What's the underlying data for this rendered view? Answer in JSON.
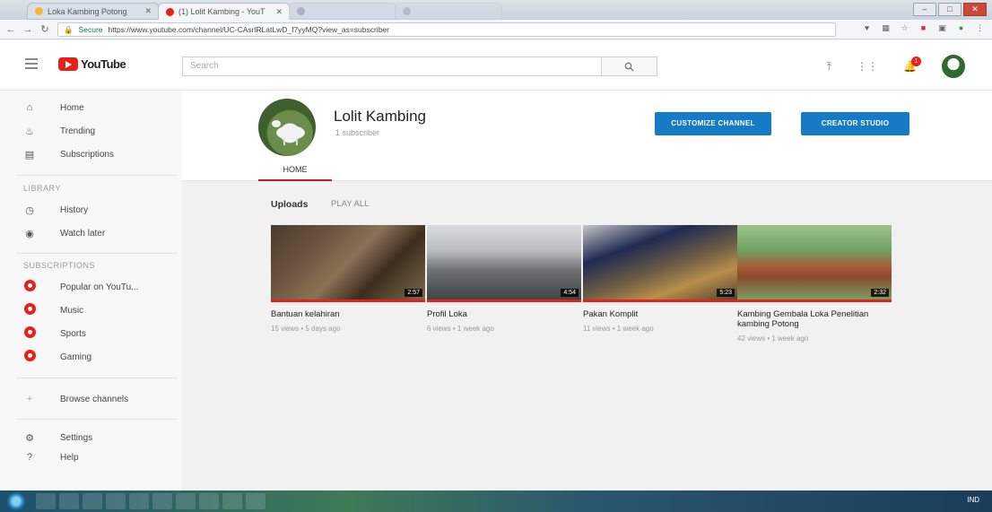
{
  "browser": {
    "tabs": [
      {
        "label": "Loka Kambing Potong",
        "icon_color": "#f2b632"
      },
      {
        "label": "(1) Lolit Kambing - YouT",
        "icon_color": "#e62117"
      },
      {
        "label": "",
        "icon_color": "#9aa6b5"
      },
      {
        "label": "",
        "icon_color": "#9aa6b5"
      }
    ],
    "secure_label": "Secure",
    "url": "https://www.youtube.com/channel/UC-CAsrlRLatLwD_f7yyMQ?view_as=subscriber"
  },
  "masthead": {
    "logo_text": "YouTube",
    "search_placeholder": "Search",
    "notification_count": "1"
  },
  "sidebar": {
    "main_items": [
      {
        "label": "Home",
        "icon": "home-icon"
      },
      {
        "label": "Trending",
        "icon": "flame-icon"
      },
      {
        "label": "Subscriptions",
        "icon": "subscriptions-icon"
      }
    ],
    "library_heading": "LIBRARY",
    "library_items": [
      {
        "label": "History",
        "icon": "history-icon"
      },
      {
        "label": "Watch later",
        "icon": "clock-icon"
      }
    ],
    "subscriptions_heading": "SUBSCRIPTIONS",
    "subscription_items": [
      {
        "label": "Popular on YouTu..."
      },
      {
        "label": "Music"
      },
      {
        "label": "Sports"
      },
      {
        "label": "Gaming"
      }
    ],
    "browse_channels": "Browse channels",
    "settings": "Settings",
    "help": "Help"
  },
  "channel": {
    "name": "Lolit Kambing",
    "subscribers": "1 subscriber",
    "customize_button": "CUSTOMIZE CHANNEL",
    "studio_button": "CREATOR STUDIO",
    "home_tab": "HOME"
  },
  "uploads": {
    "title": "Uploads",
    "play_all": "PLAY ALL",
    "videos": [
      {
        "title": "Bantuan kelahiran",
        "meta": "15 views • 5 days ago",
        "duration": "2:57"
      },
      {
        "title": "Profil Loka",
        "meta": "6 views • 1 week ago",
        "duration": "4:54"
      },
      {
        "title": "Pakan Komplit",
        "meta": "11 views • 1 week ago",
        "duration": "5:23"
      },
      {
        "title": "Kambing Gembala Loka Penelitian kambing Potong",
        "meta": "42 views • 1 week ago",
        "duration": "2:32"
      }
    ]
  },
  "taskbar": {
    "clock": "IND"
  }
}
